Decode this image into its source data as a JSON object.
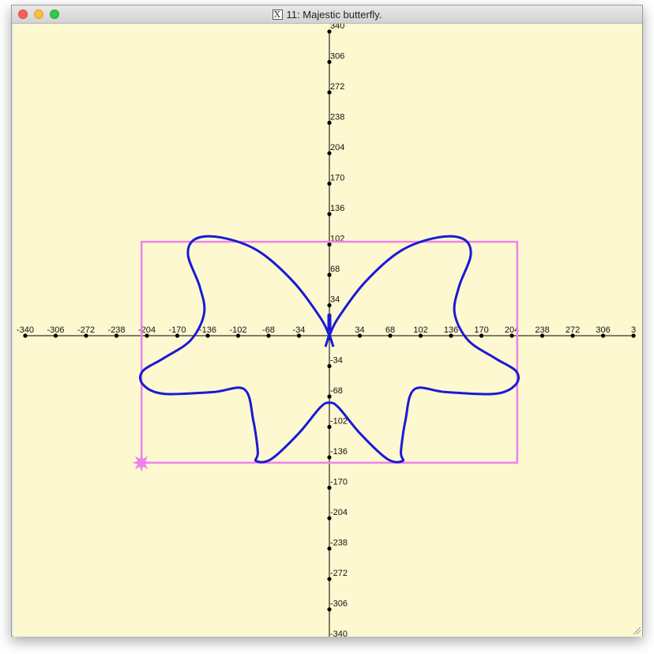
{
  "window": {
    "title": "11: Majestic butterfly.",
    "app_icon": "x11-icon"
  },
  "colors": {
    "background": "#fdf8d0",
    "axis": "#000000",
    "curve": "#1a1ad6",
    "bounding_box": "#ee82ee"
  },
  "axes": {
    "x_ticks": [
      "-340",
      "-306",
      "-272",
      "-238",
      "-204",
      "-170",
      "-136",
      "-102",
      "-68",
      "-34",
      "34",
      "68",
      "102",
      "136",
      "170",
      "204",
      "238",
      "272",
      "306",
      "3"
    ],
    "y_ticks": [
      "340",
      "306",
      "272",
      "238",
      "204",
      "170",
      "136",
      "102",
      "68",
      "34",
      "-34",
      "-68",
      "-102",
      "-136",
      "-170",
      "-204",
      "-238",
      "-272",
      "-306",
      "-340"
    ]
  },
  "chart_data": {
    "type": "line",
    "title": "",
    "xlabel": "",
    "ylabel": "",
    "xlim": [
      -340,
      340
    ],
    "ylim": [
      -340,
      340
    ],
    "grid": false,
    "series": [
      {
        "kind": "butterfly-curve",
        "x": [
          0,
          10,
          40,
          80,
          122,
          150,
          158,
          145,
          140,
          155,
          185,
          209,
          208,
          185,
          130,
          95,
          85,
          80,
          82,
          65,
          35,
          10,
          0,
          -10,
          -35,
          -65,
          -82,
          -80,
          -85,
          -95,
          -130,
          -185,
          -208,
          -209,
          -185,
          -155,
          -140,
          -145,
          -158,
          -150,
          -122,
          -80,
          -40,
          -10,
          0
        ],
        "y": [
          0,
          20,
          60,
          95,
          110,
          108,
          90,
          55,
          25,
          -5,
          -25,
          -40,
          -55,
          -65,
          -63,
          -60,
          -95,
          -130,
          -140,
          -138,
          -110,
          -80,
          -75,
          -80,
          -110,
          -138,
          -140,
          -130,
          -95,
          -60,
          -63,
          -65,
          -55,
          -40,
          -25,
          -5,
          25,
          55,
          90,
          108,
          110,
          95,
          60,
          20,
          0
        ]
      }
    ],
    "bounding_box": {
      "x": [
        -210,
        210
      ],
      "y": [
        -142,
        105
      ]
    },
    "marker": {
      "x": -210,
      "y": -142,
      "shape": "star"
    }
  }
}
